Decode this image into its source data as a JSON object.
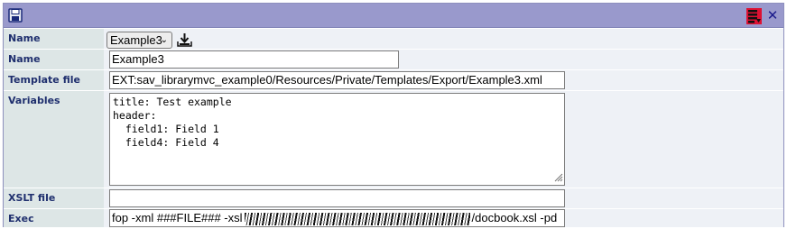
{
  "toolbar": {
    "save_icon": "floppy-disk-icon",
    "export_icon": "export-list-icon",
    "close_icon": "close-icon",
    "close_glyph": "✕"
  },
  "form": {
    "config_select": {
      "label": "Name",
      "selected": "Example3"
    },
    "name": {
      "label": "Name",
      "value": "Example3"
    },
    "template_file": {
      "label": "Template file",
      "value": "EXT:sav_librarymvc_example0/Resources/Private/Templates/Export/Example3.xml"
    },
    "variables": {
      "label": "Variables",
      "value": "title: Test example\nheader:\n  field1: Field 1\n  field4: Field 4"
    },
    "xslt_file": {
      "label": "XSLT file",
      "value": ""
    },
    "exec": {
      "label": "Exec",
      "value_start": "fop -xml ###FILE### -xsl",
      "value_end": "/docbook.xsl -pd"
    }
  },
  "colors": {
    "titlebar": "#9999cc",
    "label_bg": "#dde6e6",
    "value_bg": "#eef1f6",
    "label_text": "#1f2f6e",
    "export_red": "#dd1133"
  }
}
